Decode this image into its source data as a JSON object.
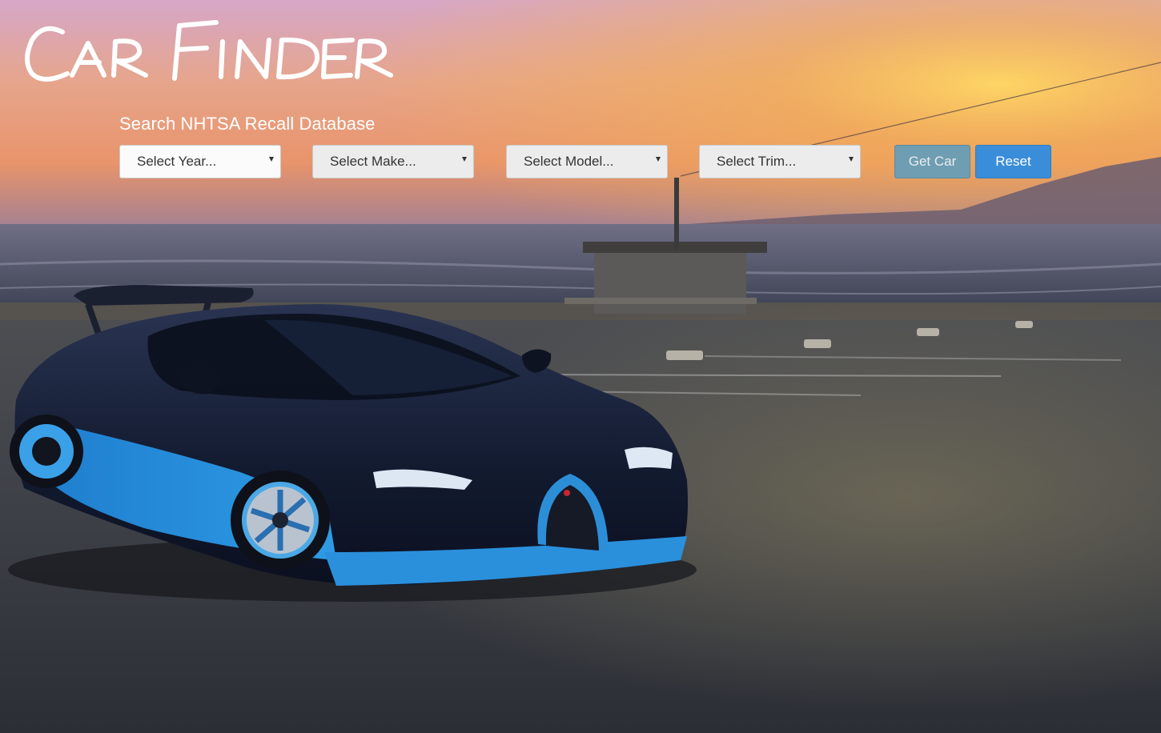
{
  "header": {
    "logo_text": "CAR FINDER",
    "subtitle": "Search NHTSA Recall Database"
  },
  "search": {
    "year": {
      "selected": "Select Year..."
    },
    "make": {
      "selected": "Select Make..."
    },
    "model": {
      "selected": "Select Model..."
    },
    "trim": {
      "selected": "Select Trim..."
    }
  },
  "buttons": {
    "get_car": "Get Car",
    "reset": "Reset"
  },
  "colors": {
    "get_car_bg": "#6f9db1",
    "reset_bg": "#3a8dd8",
    "car_accent": "#2f8fd6"
  }
}
